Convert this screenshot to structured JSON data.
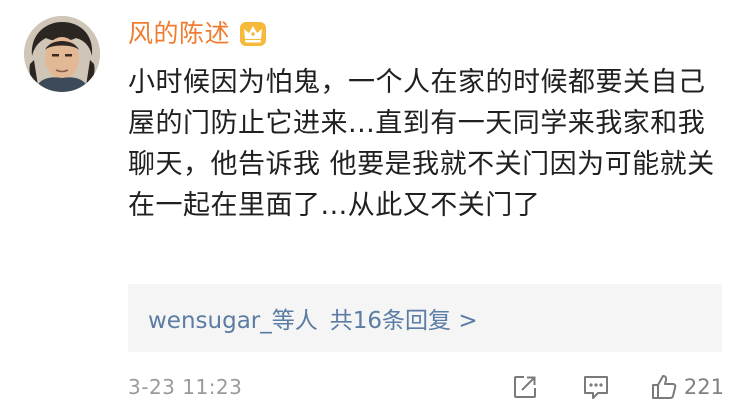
{
  "comment": {
    "username": "风的陈述",
    "badge_icon": "crown-badge-icon",
    "username_color": "#f07c30",
    "text": "小时候因为怕鬼，一个人在家的时候都要关自己屋的门防止它进来...直到有一天同学来我家和我聊天，他告诉我 他要是我就不关门因为可能就关在一起在里面了...从此又不关门了",
    "replies": {
      "users_label": "wensugar_等人",
      "count_label": "共16条回复 >"
    },
    "timestamp": "3-23 11:23",
    "actions": {
      "share_icon": "share-icon",
      "reply_icon": "comment-icon",
      "like_icon": "thumbs-up-icon",
      "like_count": "221"
    }
  },
  "colors": {
    "link": "#5b7ca3",
    "text": "#202020",
    "muted": "#9a9a9a",
    "replies_bg": "#f5f5f5"
  }
}
